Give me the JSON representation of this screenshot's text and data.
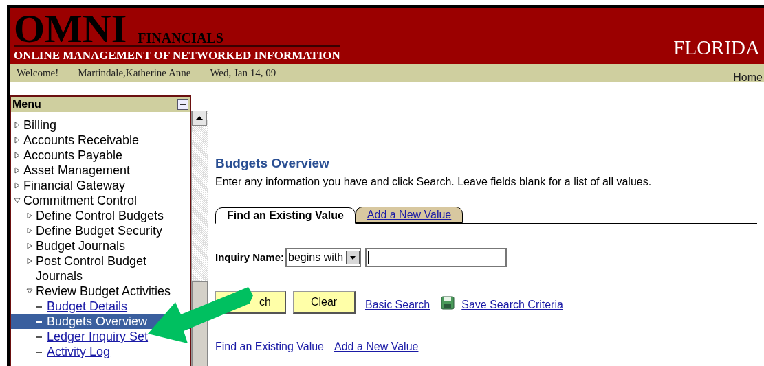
{
  "header": {
    "logo": "OMNI",
    "logo_sub": "FINANCIALS",
    "tagline": "ONLINE MANAGEMENT OF NETWORKED INFORMATION",
    "state": "FLORIDA"
  },
  "welcome_bar": {
    "greeting": "Welcome!",
    "user": "Martindale,Katherine Anne",
    "date": "Wed, Jan 14, 09",
    "home_link": "Home"
  },
  "menu": {
    "title": "Menu",
    "items": [
      {
        "label": "Billing",
        "kind": "folder",
        "expanded": false,
        "selected": false
      },
      {
        "label": "Accounts Receivable",
        "kind": "folder",
        "expanded": false,
        "selected": false
      },
      {
        "label": "Accounts Payable",
        "kind": "folder",
        "expanded": false,
        "selected": false
      },
      {
        "label": "Asset Management",
        "kind": "folder",
        "expanded": false,
        "selected": false
      },
      {
        "label": "Financial Gateway",
        "kind": "folder",
        "expanded": false,
        "selected": false
      },
      {
        "label": "Commitment Control",
        "kind": "folder",
        "expanded": true,
        "selected": false,
        "children": [
          {
            "label": "Define Control Budgets",
            "kind": "folder",
            "expanded": false,
            "selected": false
          },
          {
            "label": "Define Budget Security",
            "kind": "folder",
            "expanded": false,
            "selected": false
          },
          {
            "label": "Budget Journals",
            "kind": "folder",
            "expanded": false,
            "selected": false
          },
          {
            "label": "Post Control Budget Journals",
            "kind": "folder",
            "expanded": false,
            "selected": false
          },
          {
            "label": "Review Budget Activities",
            "kind": "folder",
            "expanded": true,
            "selected": false,
            "children": [
              {
                "label": "Budget Details",
                "kind": "link",
                "selected": false
              },
              {
                "label": "Budgets Overview",
                "kind": "link",
                "selected": true
              },
              {
                "label": "Ledger Inquiry Set",
                "kind": "link",
                "selected": false
              },
              {
                "label": "Activity Log",
                "kind": "link",
                "selected": false
              }
            ]
          }
        ]
      }
    ]
  },
  "page": {
    "title": "Budgets Overview",
    "instructions": "Enter any information you have and click Search. Leave fields blank for a list of all values.",
    "tabs": [
      {
        "label": "Find an Existing Value",
        "selected": true
      },
      {
        "label": "Add a New Value",
        "selected": false
      }
    ],
    "inquiry": {
      "label": "Inquiry Name:",
      "operator": "begins with"
    },
    "buttons": [
      "ch",
      "Clear"
    ],
    "links": [
      "Basic Search",
      "Save Search Criteria"
    ],
    "bottom_links": [
      {
        "label": "Find an Existing Value",
        "selected": true
      },
      {
        "label": "Add a New Value",
        "selected": false
      }
    ]
  }
}
